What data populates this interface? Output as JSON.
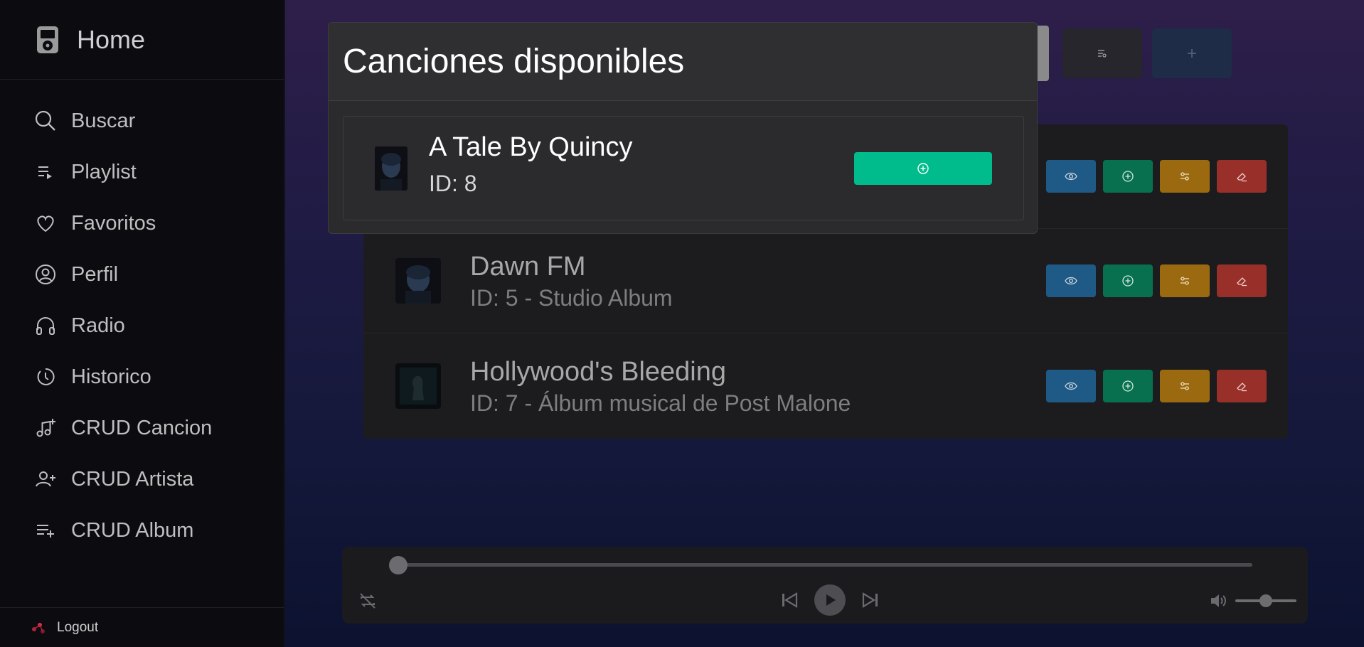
{
  "sidebar": {
    "brand": "Home",
    "items": [
      {
        "label": "Buscar",
        "icon": "search-icon"
      },
      {
        "label": "Playlist",
        "icon": "playlist-icon"
      },
      {
        "label": "Favoritos",
        "icon": "heart-icon"
      },
      {
        "label": "Perfil",
        "icon": "user-circle-icon"
      },
      {
        "label": "Radio",
        "icon": "headphones-icon"
      },
      {
        "label": "Historico",
        "icon": "history-icon"
      },
      {
        "label": "CRUD Cancion",
        "icon": "music-add-icon"
      },
      {
        "label": "CRUD Artista",
        "icon": "user-add-icon"
      },
      {
        "label": "CRUD Album",
        "icon": "list-add-icon"
      }
    ],
    "logout": "Logout"
  },
  "albums": [
    {
      "title": "",
      "subtitle": ""
    },
    {
      "title": "Dawn FM",
      "subtitle": "ID: 5 - Studio Album"
    },
    {
      "title": "Hollywood's Bleeding",
      "subtitle": "ID: 7 - Álbum musical de Post Malone"
    }
  ],
  "modal": {
    "title": "Canciones disponibles",
    "song": {
      "title": "A Tale By Quincy",
      "id": "ID: 8"
    }
  },
  "player": {
    "progress": 0.0,
    "volume": 0.5
  },
  "colors": {
    "accent_green": "#00bc8c",
    "view": "#1f5a86",
    "add": "#08704f",
    "edit": "#9a6910",
    "delete": "#983029"
  }
}
